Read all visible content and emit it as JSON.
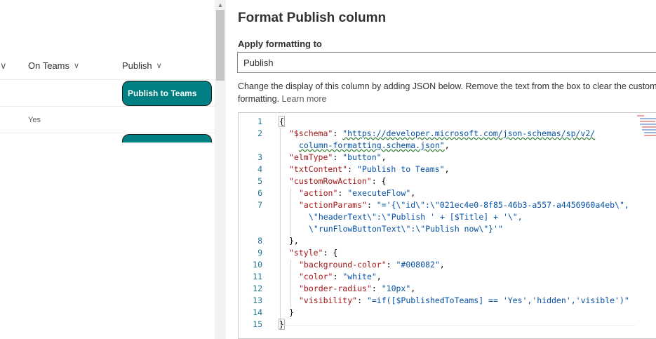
{
  "list": {
    "first_col_chevron": "∨",
    "columns": [
      {
        "label": "On Teams"
      },
      {
        "label": "Publish"
      }
    ],
    "rows": [
      {
        "on_teams": "",
        "publish_button": "Publish to Teams"
      },
      {
        "on_teams": "Yes",
        "publish_button": ""
      }
    ]
  },
  "panel": {
    "title": "Format Publish column",
    "apply_label": "Apply formatting to",
    "apply_value": "Publish",
    "description": "Change the display of this column by adding JSON below. Remove the text from the box to clear the custom formatting.",
    "learn_more": "Learn more"
  },
  "editor": {
    "line_numbers": [
      "1",
      "2",
      "",
      "3",
      "4",
      "5",
      "6",
      "7",
      "",
      "",
      "8",
      "9",
      "10",
      "11",
      "12",
      "13",
      "14",
      "15"
    ],
    "lines": {
      "l1": "{",
      "l2_key": "\"$schema\"",
      "l2_url_a": "\"https://developer.microsoft.com/json-schemas/sp/v2/",
      "l2_url_b": "column-formatting.schema.json\"",
      "l3_key": "\"elmType\"",
      "l3_val": "\"button\"",
      "l4_key": "\"txtContent\"",
      "l4_val": "\"Publish to Teams\"",
      "l5_key": "\"customRowAction\"",
      "l6_key": "\"action\"",
      "l6_val": "\"executeFlow\"",
      "l7_key": "\"actionParams\"",
      "l7_val_a": "\"='{\\\"id\\\":\\\"021ec4e0-8f85-46b3-a557-a4456960a4eb\\\",",
      "l7_val_b": "\\\"headerText\\\":\\\"Publish ' + [$Title] + '\\\",",
      "l7_val_c": "\\\"runFlowButtonText\\\":\\\"Publish now\\\"}'\"",
      "l8": "},",
      "l9_key": "\"style\"",
      "l10_key": "\"background-color\"",
      "l10_val": "\"#008082\"",
      "l11_key": "\"color\"",
      "l11_val": "\"white\"",
      "l12_key": "\"border-radius\"",
      "l12_val": "\"10px\"",
      "l13_key": "\"visibility\"",
      "l13_val": "\"=if([$PublishedToTeams] == 'Yes','hidden','visible')\"",
      "l14": "}",
      "l15": "}"
    }
  },
  "colors": {
    "accent": "#008082",
    "json_key": "#a31515",
    "json_string": "#0451a5",
    "line_number": "#237893"
  }
}
